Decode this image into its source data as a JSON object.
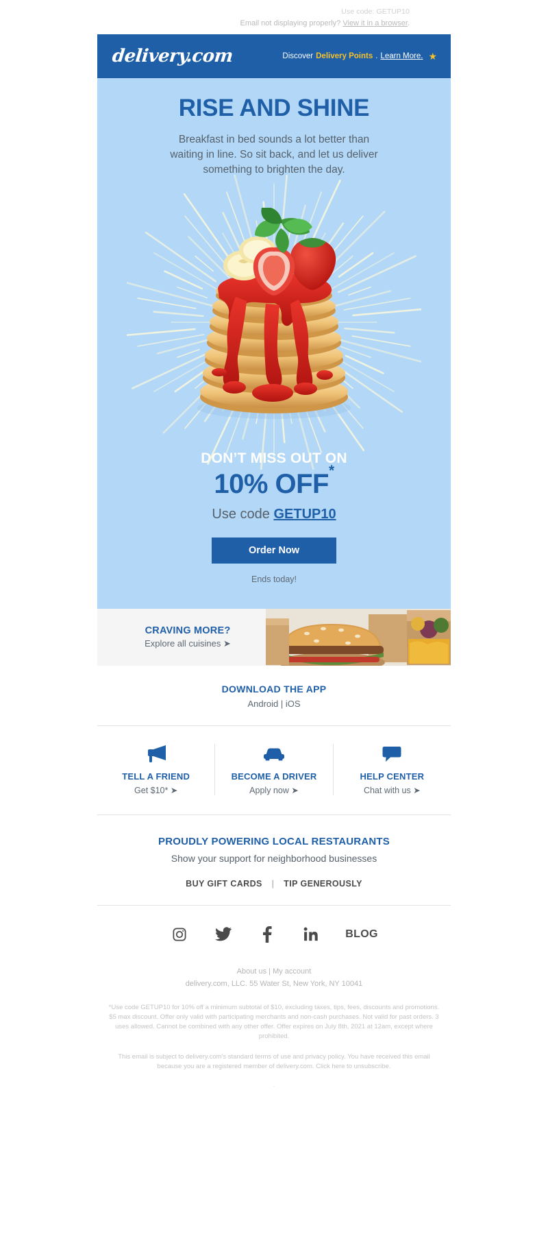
{
  "preheader": {
    "use_code": "Use code: GETUP10",
    "not_displaying": "Email not displaying properly?",
    "view_link": "View it in a browser",
    "period": "."
  },
  "header": {
    "logo": "delivery.com",
    "discover": "Discover",
    "points": "Delivery Points",
    "dot": ".",
    "learn_more": "Learn More.",
    "star_icon": "star-icon"
  },
  "hero": {
    "headline": "RISE AND SHINE",
    "subhead": "Breakfast in bed sounds a lot better than waiting in line. So sit back, and let us deliver something to brighten the day.",
    "image_alt": "pancake-stack-with-strawberry-banana-mint"
  },
  "offer": {
    "dont_miss": "DON’T MISS OUT ON",
    "percent": "10% OFF",
    "asterisk": "*",
    "use_code_label": "Use code",
    "code": "GETUP10",
    "cta_label": "Order Now",
    "ends": "Ends today!"
  },
  "craving": {
    "title": "CRAVING MORE?",
    "subtitle": "Explore all cuisines ➤",
    "image_alt": "burger-and-takeout-boxes"
  },
  "app": {
    "title": "DOWNLOAD THE APP",
    "android": "Android",
    "separator": "|",
    "ios": "iOS"
  },
  "columns": [
    {
      "icon": "megaphone-icon",
      "title": "TELL A FRIEND",
      "subtitle": "Get $10* ➤"
    },
    {
      "icon": "car-icon",
      "title": "BECOME A DRIVER",
      "subtitle": "Apply now ➤"
    },
    {
      "icon": "chat-bubble-icon",
      "title": "HELP CENTER",
      "subtitle": "Chat with us ➤"
    }
  ],
  "local": {
    "title": "PROUDLY POWERING LOCAL RESTAURANTS",
    "subtitle": "Show your support for neighborhood businesses",
    "link1": "BUY GIFT CARDS",
    "separator": "|",
    "link2": "TIP GENEROUSLY"
  },
  "social": {
    "instagram": "instagram-icon",
    "twitter": "twitter-icon",
    "facebook": "facebook-icon",
    "linkedin": "linkedin-icon",
    "blog": "BLOG"
  },
  "footer": {
    "about_us": "About us",
    "separator": "|",
    "my_account": "My account",
    "address": "delivery.com, LLC. 55 Water St, New York, NY 10041",
    "fine_print": "*Use code GETUP10 for 10% off a minimum subtotal of $10, excluding taxes, tips, fees, discounts and promotions. $5 max discount. Offer only valid with participating merchants and non-cash purchases. Not valid for past orders. 3 uses allowed. Cannot be combined with any other offer. Offer expires on July 8th, 2021 at 12am, except where prohibited.",
    "legal": "This email is subject to delivery.com's standard terms of use and privacy policy. You have received this email because you are a registered member of delivery.com. Click here to unsubscribe.",
    "dot": "."
  },
  "colors": {
    "brand_blue": "#1f5fa8",
    "hero_bg": "#b3d8f7",
    "gold": "#f5c02b",
    "body_text": "#55606b"
  }
}
